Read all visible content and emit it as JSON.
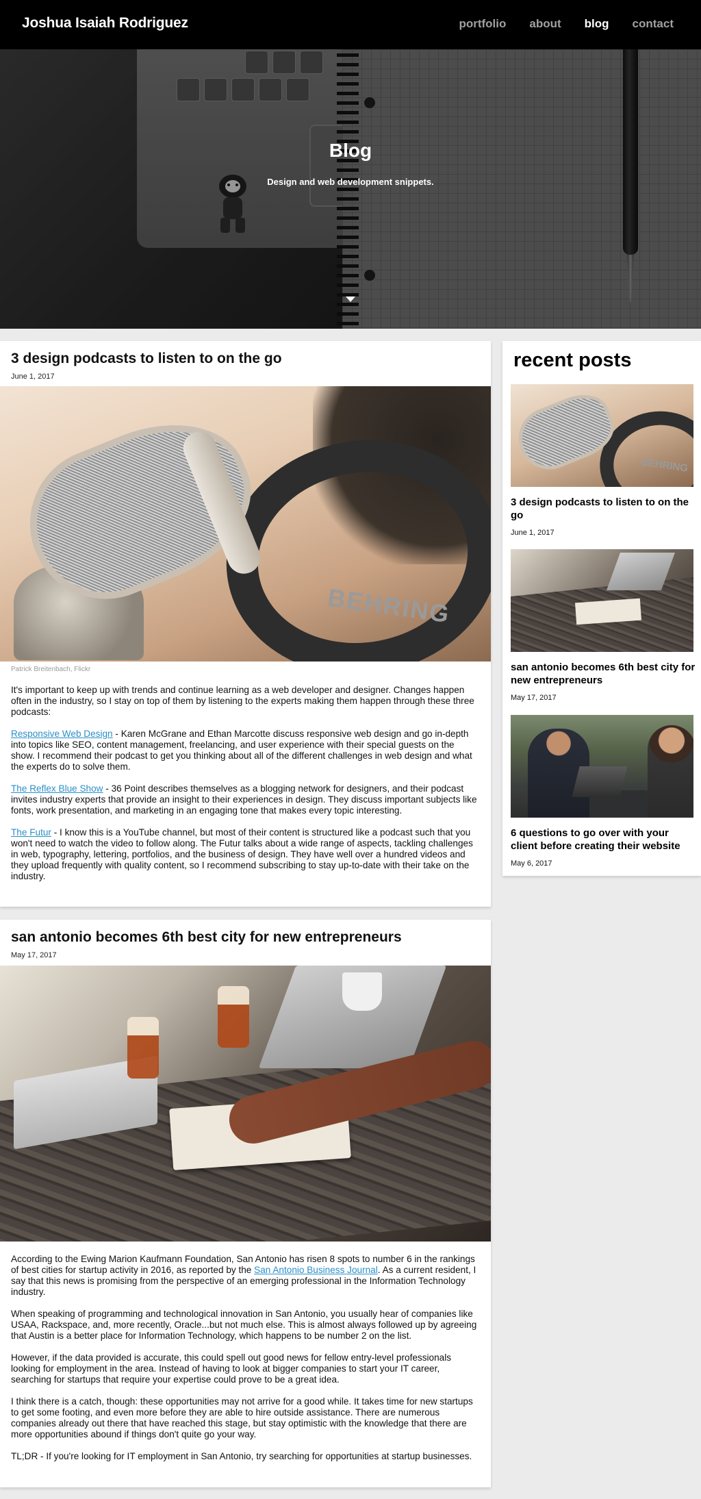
{
  "nav": {
    "brand": "Joshua Isaiah Rodriguez",
    "links": [
      {
        "label": "portfolio",
        "active": false
      },
      {
        "label": "about",
        "active": false
      },
      {
        "label": "blog",
        "active": true
      },
      {
        "label": "contact",
        "active": false
      }
    ]
  },
  "hero": {
    "title": "Blog",
    "subtitle": "Design and web development snippets.",
    "arrow_icon": "chevron-down-icon"
  },
  "posts": [
    {
      "title": "3 design podcasts to listen to on the go",
      "date": "June 1, 2017",
      "image_caption": "Patrick Breitenbach, Flickr",
      "image_text": "BEHRING",
      "intro": "It's important to keep up with trends and continue learning as a web developer and designer. Changes happen often in the industry, so I stay on top of them by listening to the experts making them happen through these three podcasts:",
      "items": [
        {
          "link": "Responsive Web Design",
          "text": " - Karen McGrane and Ethan Marcotte discuss responsive web design and go in-depth into topics like SEO, content management, freelancing, and user experience with their special guests on the show. I recommend their podcast to get you thinking about all of the different challenges in web design and what the experts do to solve them."
        },
        {
          "link": "The Reflex Blue Show",
          "text": " - 36 Point describes themselves as a blogging network for designers, and their podcast invites industry experts that provide an insight to their experiences in design. They discuss important subjects like fonts, work presentation, and marketing in an engaging tone that makes every topic interesting."
        },
        {
          "link": "The Futur",
          "text": " - I know this is a YouTube channel, but most of their content is structured like a podcast such that you won't need to watch the video to follow along. The Futur talks about a wide range of aspects, tackling challenges in web, typography, lettering, portfolios, and the business of design. They have well over a hundred videos and they upload frequently with quality content, so I recommend subscribing to stay up-to-date with their take on the industry."
        }
      ]
    },
    {
      "title": "san antonio becomes 6th best city for new entrepreneurs",
      "date": "May 17, 2017",
      "p1_before": "According to the Ewing Marion Kaufmann Foundation, San Antonio has risen 8 spots to number 6 in the rankings of best cities for startup activity in 2016, as reported by the ",
      "p1_link": "San Antonio Business Journal",
      "p1_after": ". As a current resident, I say that this news is promising from the perspective of an emerging professional in the Information Technology industry.",
      "p2": "When speaking of programming and technological innovation in San Antonio, you usually hear of companies like USAA, Rackspace, and, more recently, Oracle...but not much else. This is almost always followed up by agreeing that Austin is a better place for Information Technology, which happens to be number 2 on the list.",
      "p3": "However, if the data provided is accurate, this could spell out good news for fellow entry-level professionals looking for employment in the area. Instead of having to look at bigger companies to start your IT career, searching for startups that require your expertise could prove to be a great idea.",
      "p4": "I think there is a catch, though: these opportunities may not arrive for a good while. It takes time for new startups to get some footing, and even more before they are able to hire outside assistance. There are numerous companies already out there that have reached this stage, but stay optimistic with the knowledge that there are more opportunities abound if things don't quite go your way.",
      "p5": "TL;DR - If you're looking for IT employment in San Antonio, try searching for opportunities at startup businesses."
    }
  ],
  "sidebar": {
    "title": "recent posts",
    "items": [
      {
        "title": "3 design podcasts to listen to on the go",
        "date": "June 1, 2017",
        "thumb_text": "BEHRING"
      },
      {
        "title": "san antonio becomes 6th best city for new entrepreneurs",
        "date": "May 17, 2017"
      },
      {
        "title": "6 questions to go over with your client before creating their website",
        "date": "May 6, 2017"
      }
    ]
  },
  "colors": {
    "nav_bg": "#000000",
    "link": "#2a8fc9",
    "page_bg": "#ebebeb"
  }
}
